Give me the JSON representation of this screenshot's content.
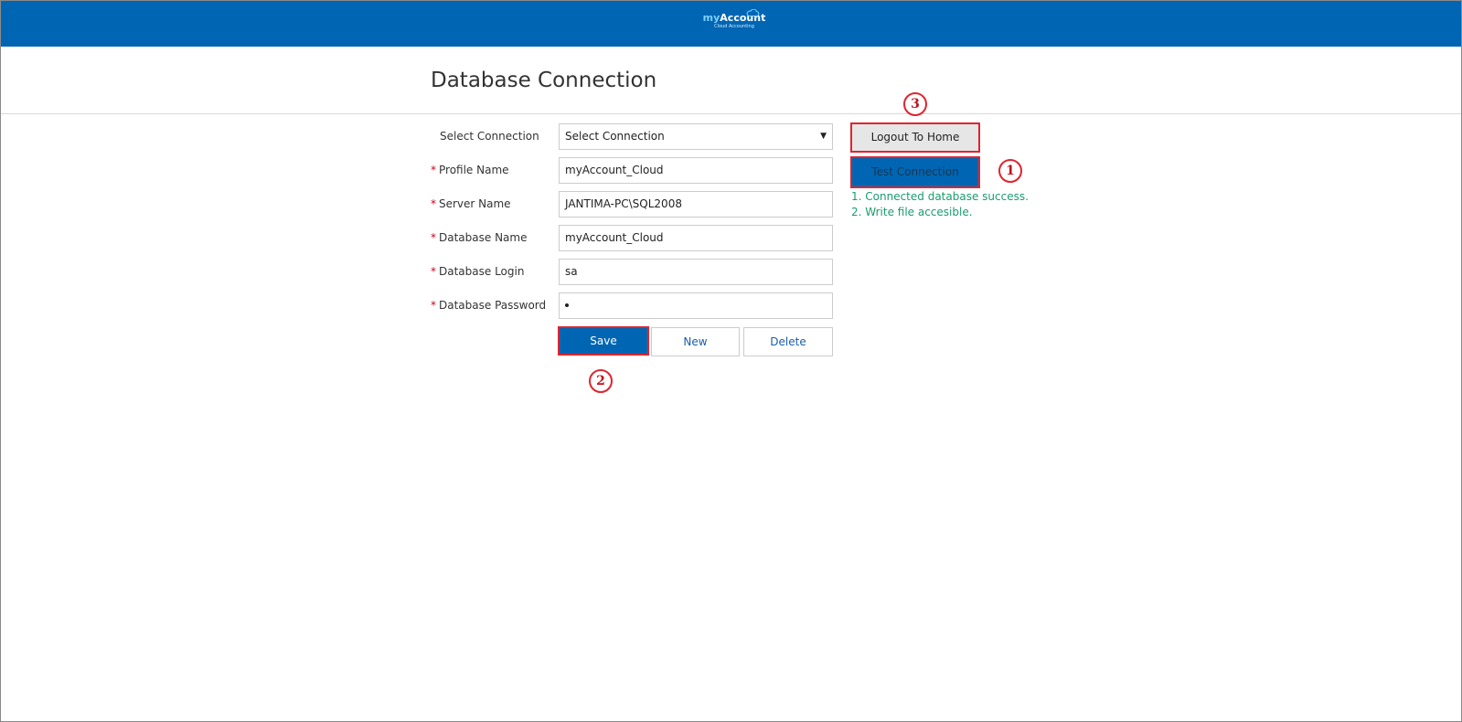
{
  "header": {
    "logo_my": "my",
    "logo_account": "Account",
    "logo_sub": "Cloud Accounting",
    "background": "#0066b3"
  },
  "page": {
    "title": "Database Connection"
  },
  "form": {
    "required_mark": "*",
    "select_connection": {
      "label": "Select Connection",
      "value": "Select Connection"
    },
    "profile_name": {
      "label": "Profile Name",
      "value": "myAccount_Cloud"
    },
    "server_name": {
      "label": "Server Name",
      "value": "JANTIMA-PC\\SQL2008"
    },
    "database_name": {
      "label": "Database Name",
      "value": "myAccount_Cloud"
    },
    "database_login": {
      "label": "Database Login",
      "value": "sa"
    },
    "database_password": {
      "label": "Database Password"
    }
  },
  "buttons": {
    "save": "Save",
    "new": "New",
    "delete": "Delete",
    "logout": "Logout To Home",
    "test": "Test Connection"
  },
  "status": {
    "lines": [
      "1. Connected database success.",
      "2. Write file accesible."
    ],
    "color": "#1b9c6e"
  },
  "markers": {
    "one": "1",
    "two": "2",
    "three": "3"
  },
  "accent_red": "#e0242f"
}
